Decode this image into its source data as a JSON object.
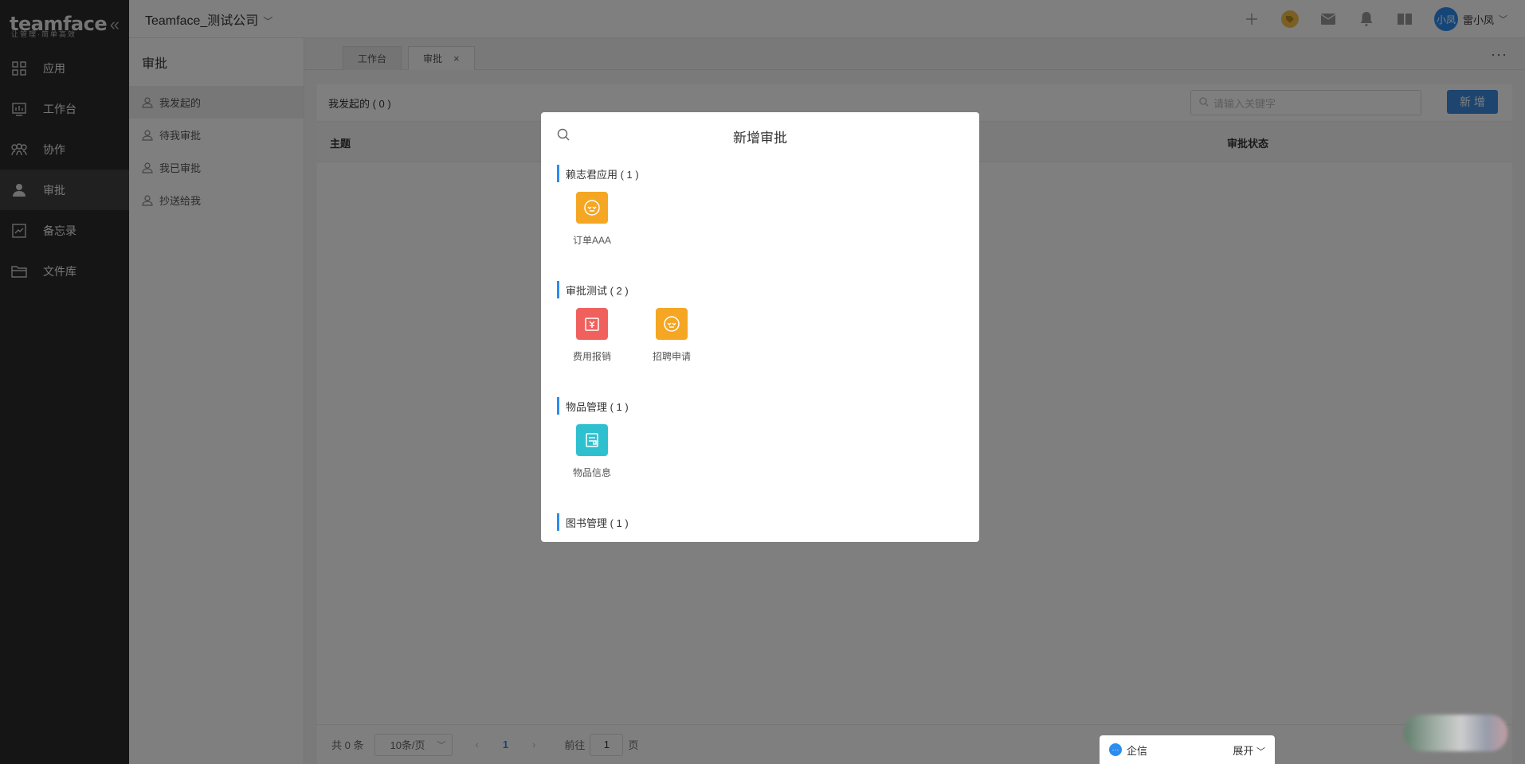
{
  "logo": {
    "text": "teamface",
    "sub": "让管理·简单高效"
  },
  "header": {
    "company": "Teamface_测试公司",
    "user_initials": "小凤",
    "user_name": "雷小凤"
  },
  "sidebar": {
    "items": [
      {
        "label": "应用",
        "icon": "grid-icon"
      },
      {
        "label": "工作台",
        "icon": "chart-icon"
      },
      {
        "label": "协作",
        "icon": "group-icon"
      },
      {
        "label": "审批",
        "icon": "person-icon"
      },
      {
        "label": "备忘录",
        "icon": "memo-icon"
      },
      {
        "label": "文件库",
        "icon": "folder-icon"
      }
    ]
  },
  "subside": {
    "title": "审批",
    "items": [
      {
        "label": "我发起的"
      },
      {
        "label": "待我审批"
      },
      {
        "label": "我已审批"
      },
      {
        "label": "抄送给我"
      }
    ]
  },
  "tabs": [
    {
      "label": "工作台"
    },
    {
      "label": "审批",
      "close": "×"
    }
  ],
  "main": {
    "heading": "我发起的 ( 0 )",
    "search_placeholder": "请输入关键字",
    "new_button": "新 增",
    "columns": {
      "subject": "主题",
      "status": "审批状态"
    }
  },
  "pager": {
    "total": "共 0 条",
    "page_size": "10条/页",
    "current": "1",
    "goto": "前往",
    "goto_value": "1",
    "page_unit": "页"
  },
  "modal": {
    "title": "新增审批",
    "groups": [
      {
        "title": "赖志君应用 ( 1 )",
        "apps": [
          {
            "label": "订单AAA",
            "color": "#f5a623"
          }
        ]
      },
      {
        "title": "审批测试 ( 2 )",
        "apps": [
          {
            "label": "费用报销",
            "color": "#f0605d"
          },
          {
            "label": "招聘申请",
            "color": "#f5a623"
          }
        ]
      },
      {
        "title": "物品管理 ( 1 )",
        "apps": [
          {
            "label": "物品信息",
            "color": "#2ec0cf"
          }
        ]
      },
      {
        "title": "图书管理 ( 1 )",
        "apps": []
      }
    ]
  },
  "chat": {
    "label": "企信",
    "expand": "展开"
  }
}
